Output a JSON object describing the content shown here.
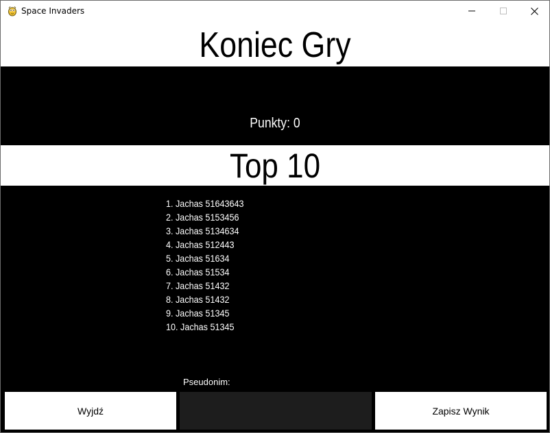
{
  "window": {
    "title": "Space Invaders",
    "icon": "pygame-snake-icon",
    "controls": [
      "minimize-icon",
      "maximize-icon",
      "close-icon"
    ]
  },
  "game_over": {
    "title": "Koniec Gry",
    "score_text": "Punkty: 0"
  },
  "leaderboard": {
    "title": "Top 10",
    "entries": [
      "1. Jachas 51643643",
      "2. Jachas 5153456",
      "3. Jachas 5134634",
      "4. Jachas 512443",
      "5. Jachas 51634",
      "6. Jachas 51534",
      "7. Jachas 51432",
      "8. Jachas 51432",
      "9. Jachas 51345",
      "10. Jachas 51345"
    ]
  },
  "controls": {
    "exit_label": "Wyjdź",
    "nickname_label": "Pseudonim:",
    "nickname_value": "",
    "save_label": "Zapisz Wynik"
  },
  "colors": {
    "background": "#000000",
    "band": "#ffffff",
    "input_bg": "#1d1d1d"
  }
}
